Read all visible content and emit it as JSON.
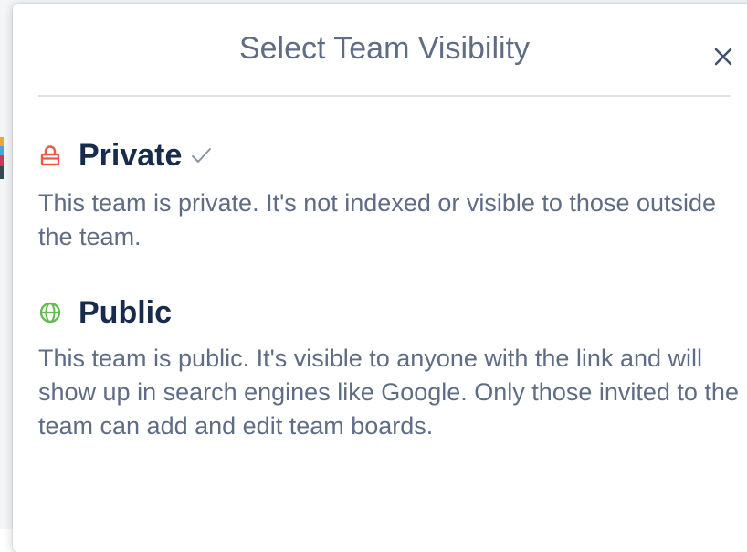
{
  "dialog": {
    "title": "Select Team Visibility",
    "close_icon": "close-icon"
  },
  "options": [
    {
      "label": "Private",
      "icon": "lock-icon",
      "icon_color": "#eb5a46",
      "selected": true,
      "description": "This team is private. It's not indexed or visible to those outside the team."
    },
    {
      "label": "Public",
      "icon": "globe-icon",
      "icon_color": "#61bd4f",
      "selected": false,
      "description": "This team is public. It's visible to anyone with the link and will show up in search engines like Google. Only those invited to the team can add and edit team boards."
    }
  ],
  "colors": {
    "title": "#5e6c84",
    "label": "#172b4d",
    "description": "#5e6c84",
    "divider": "#dfe1e6",
    "check": "#8993a4"
  }
}
